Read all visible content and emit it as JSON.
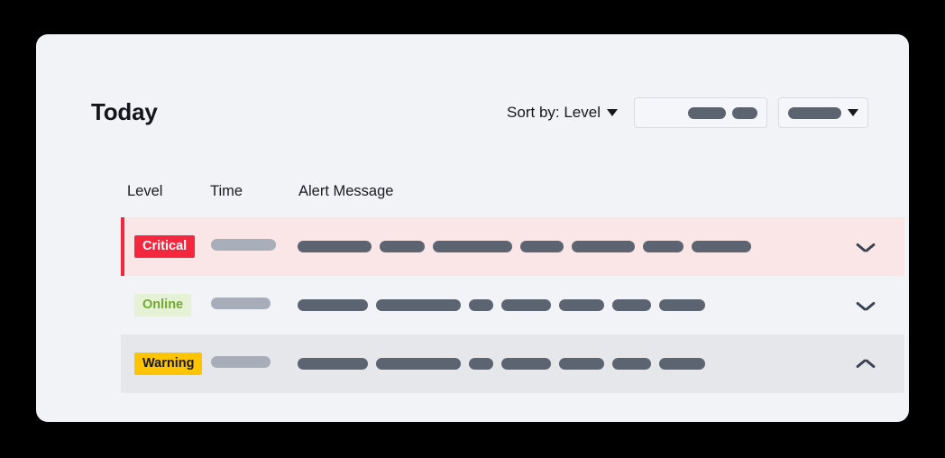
{
  "card": {
    "background_color": "#f1f3f7",
    "page_background": "#000000"
  },
  "header": {
    "title": "Today",
    "sort_label": "Sort by: Level",
    "sort_caret_icon": "chevron-down-icon",
    "toolbar": {
      "search_box": {
        "icon": "redacted-content",
        "pills": [
          42,
          28
        ]
      },
      "filter_select": {
        "pills": [
          62
        ],
        "caret_icon": "chevron-down-icon"
      }
    }
  },
  "table": {
    "columns": [
      "Level",
      "Time",
      "Alert Message"
    ],
    "rows": [
      {
        "level": "Critical",
        "level_color": "#f5273f",
        "level_text_color": "#ffffff",
        "row_background": "#fbe6e7",
        "accent_color": "#f5273f",
        "has_accent": true,
        "time_pill": 72,
        "message_pills": [
          82,
          50,
          88,
          48,
          70,
          45,
          66
        ],
        "expand_icon": "chevron-down-icon",
        "expanded": false
      },
      {
        "level": "Online",
        "level_color": "#e6f2d5",
        "level_text_color": "#72a82f",
        "row_background": "#f1f3f7",
        "accent_color": "",
        "has_accent": false,
        "time_pill": 66,
        "message_pills": [
          78,
          94,
          27,
          55,
          50,
          43,
          51
        ],
        "expand_icon": "chevron-down-icon",
        "expanded": false
      },
      {
        "level": "Warning",
        "level_color": "#ffc400",
        "level_text_color": "#16181d",
        "row_background": "#e6e7eb",
        "accent_color": "",
        "has_accent": false,
        "time_pill": 66,
        "message_pills": [
          78,
          94,
          27,
          55,
          50,
          43,
          51
        ],
        "expand_icon": "chevron-up-icon",
        "expanded": true
      }
    ]
  }
}
